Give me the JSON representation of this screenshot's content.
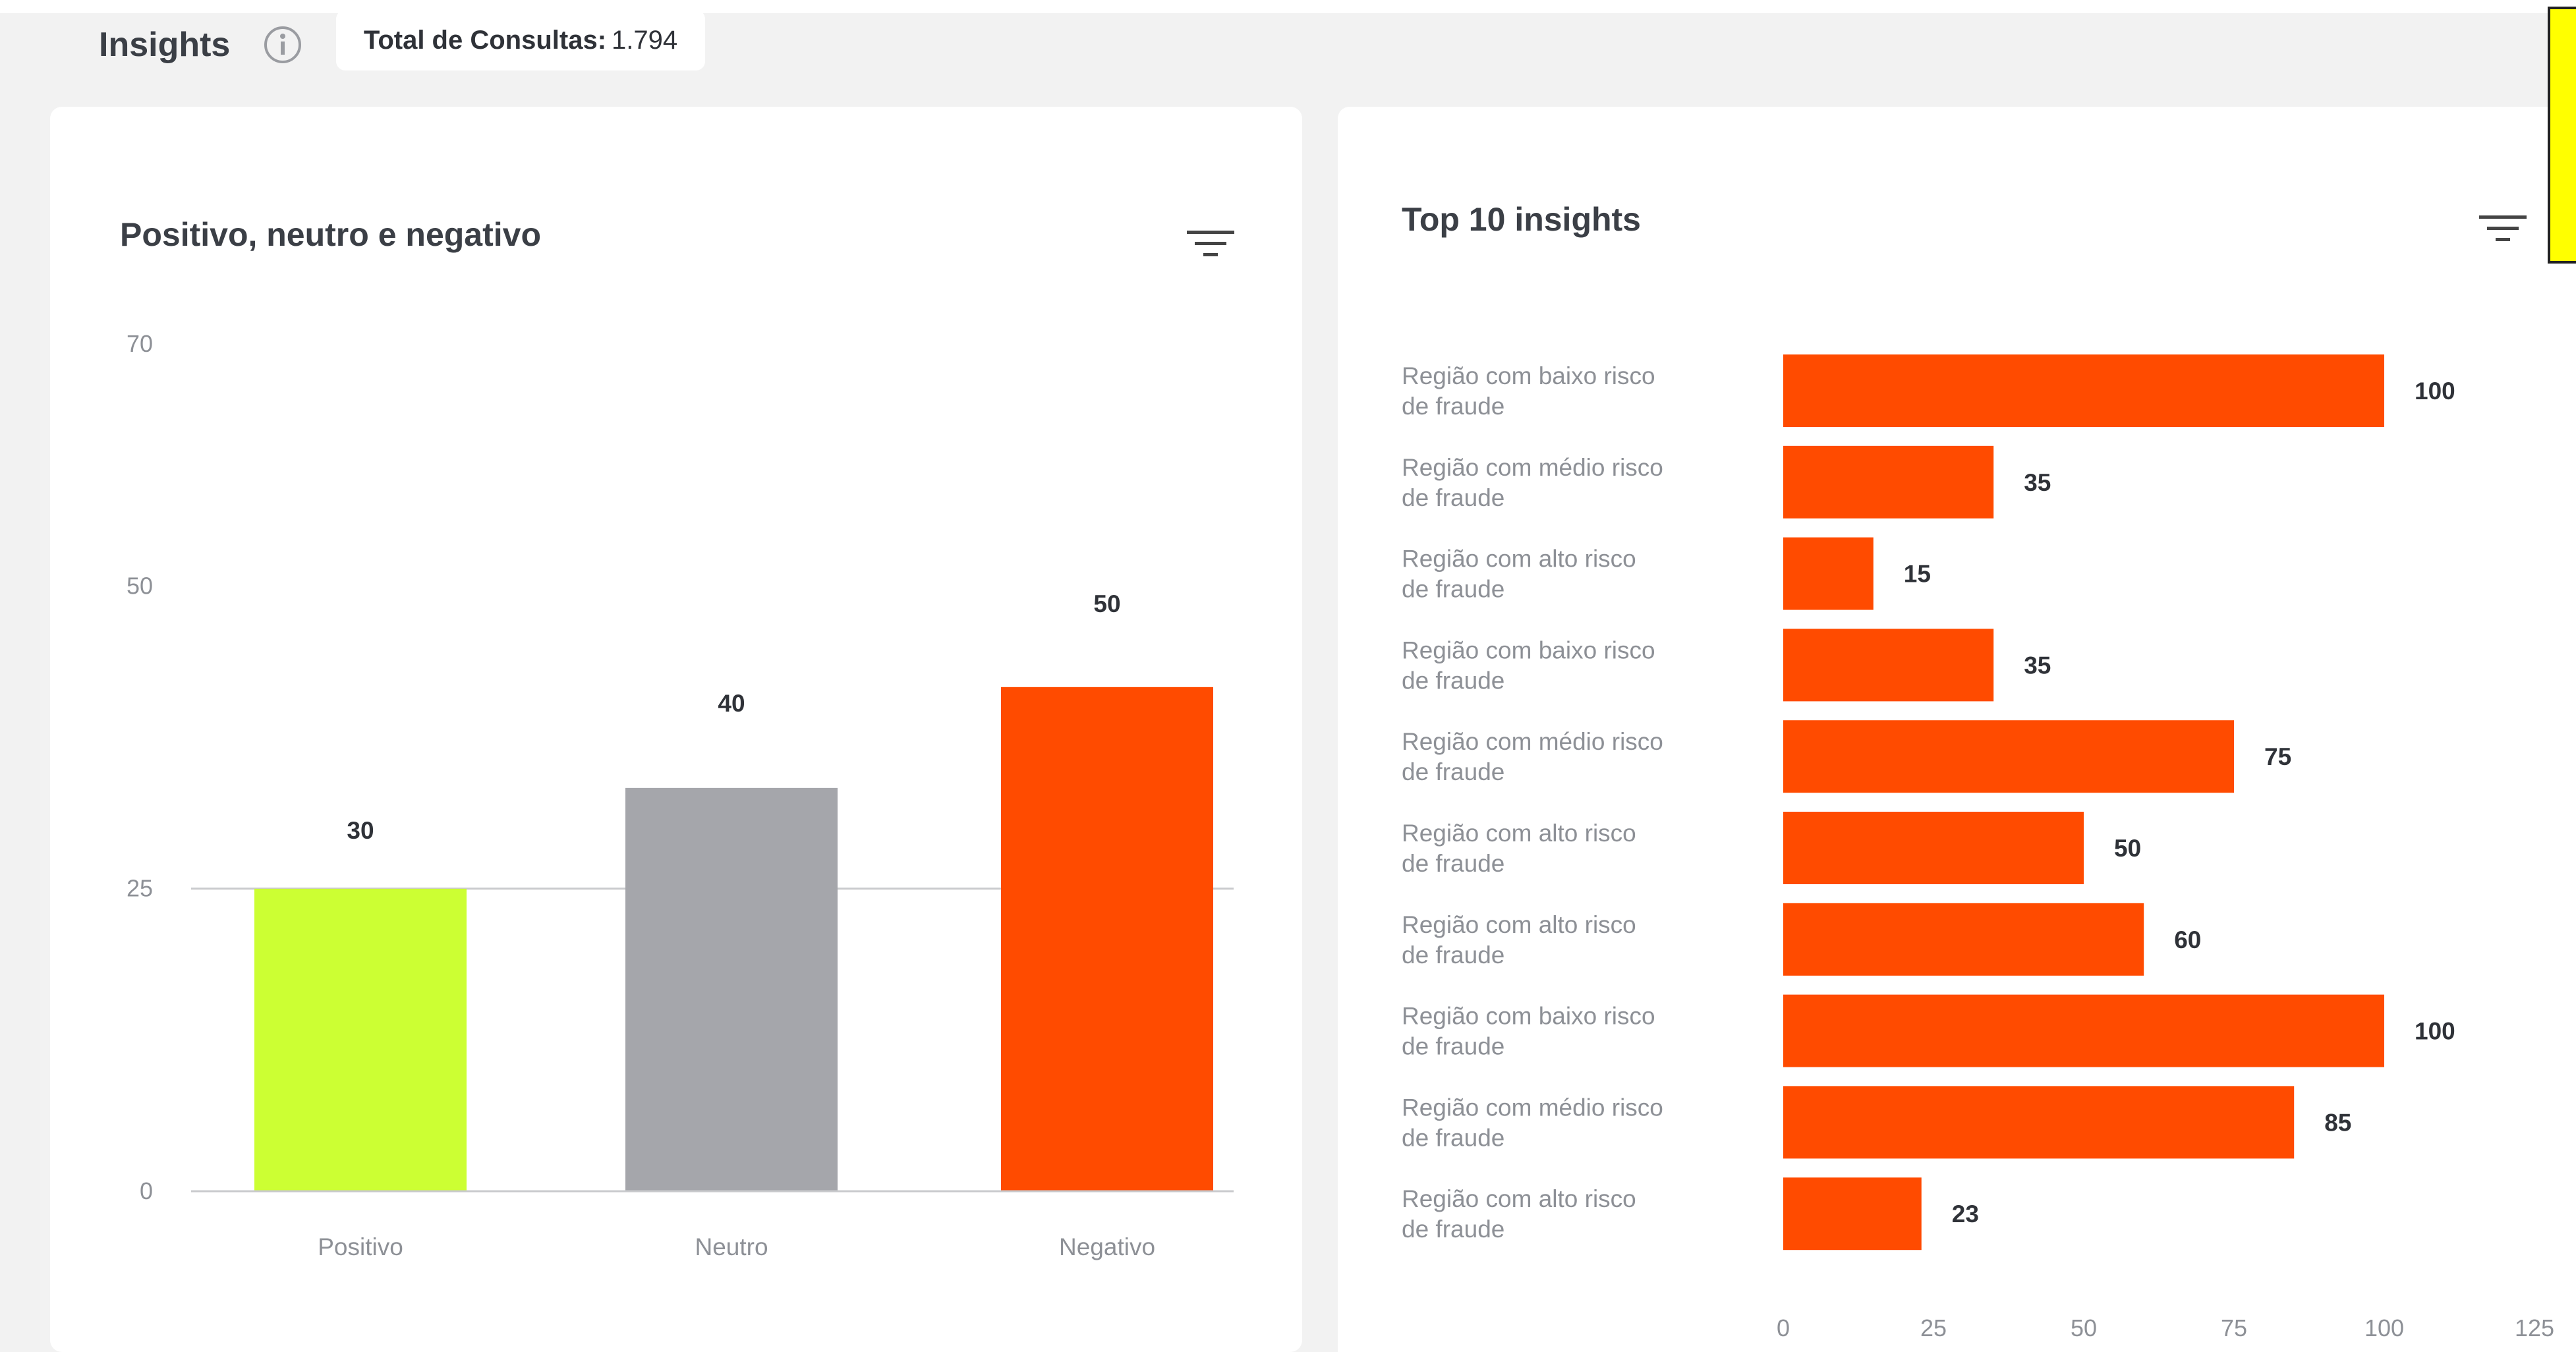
{
  "header": {
    "title": "Insights",
    "total_label": "Total de Consultas:",
    "total_value": "1.794"
  },
  "left_card": {
    "title": "Positivo, neutro e negativo"
  },
  "right_card": {
    "title": "Top 10 insights"
  },
  "icons": {
    "info": "info-icon",
    "filter": "filter-icon"
  },
  "colors": {
    "accent": "#ff4b00",
    "positive": "#ccff33",
    "neutral": "#a5a6ab"
  },
  "chart_data": [
    {
      "type": "bar",
      "title": "Positivo, neutro e negativo",
      "categories": [
        "Positivo",
        "Neutro",
        "Negativo"
      ],
      "values": [
        30,
        40,
        50
      ],
      "bar_colors": [
        "#ccff33",
        "#a5a6ab",
        "#ff4b00"
      ],
      "yticks": [
        0,
        25,
        50,
        70
      ],
      "ylim": [
        0,
        70
      ],
      "grid": "horizontal line at 25"
    },
    {
      "type": "bar",
      "orientation": "horizontal",
      "title": "Top 10 insights",
      "categories": [
        [
          "Região com baixo risco",
          "de fraude"
        ],
        [
          "Região com médio risco",
          "de fraude"
        ],
        [
          "Região com alto risco",
          "de fraude"
        ],
        [
          "Região com baixo risco",
          "de fraude"
        ],
        [
          "Região com médio risco",
          "de fraude"
        ],
        [
          "Região com alto risco",
          "de fraude"
        ],
        [
          "Região com alto risco",
          "de fraude"
        ],
        [
          "Região com baixo risco",
          "de fraude"
        ],
        [
          "Região com médio risco",
          "de fraude"
        ],
        [
          "Região com alto risco",
          "de fraude"
        ]
      ],
      "values": [
        100,
        35,
        15,
        35,
        75,
        50,
        60,
        100,
        85,
        23
      ],
      "bar_color": "#ff4b00",
      "xticks": [
        0,
        25,
        50,
        75,
        100,
        125
      ],
      "xlim": [
        0,
        125
      ]
    }
  ]
}
